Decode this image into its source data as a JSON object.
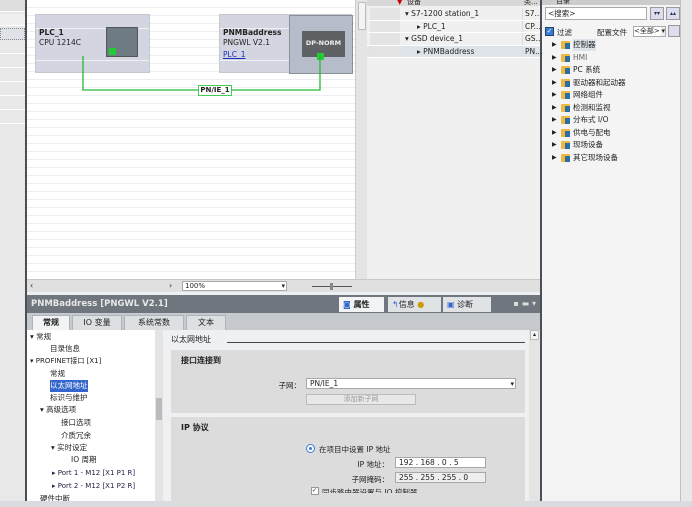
{
  "canvas": {
    "devices": [
      {
        "name": "PLC_1",
        "type": "CPU 1214C"
      },
      {
        "name": "PNMBaddress",
        "type": "PNGWL V2.1",
        "link": "PLC_1",
        "module": "DP-NORM"
      }
    ],
    "subnet_label": "PN/IE_1",
    "zoom": "100%"
  },
  "device_table": {
    "headers": [
      "设备",
      "类..."
    ],
    "rows": [
      {
        "name": "S7-1200 station_1",
        "type": "S7..."
      },
      {
        "name": "PLC_1",
        "type": "CP..."
      },
      {
        "name": "GSD device_1",
        "type": "GS..."
      },
      {
        "name": "PNMBaddress",
        "type": "PN..."
      }
    ]
  },
  "catalog": {
    "title": "目录",
    "search_placeholder": "<搜索>",
    "filter_label": "过滤",
    "profile_label": "配置文件",
    "profile_value": "<全部>",
    "items": [
      "控制器",
      "HMI",
      "PC 系统",
      "驱动器和起动器",
      "网络组件",
      "检测和监视",
      "分布式 I/O",
      "供电与配电",
      "现场设备",
      "其它现场设备"
    ]
  },
  "inspector": {
    "title": "PNMBaddress [PNGWL V2.1]",
    "view_tabs": [
      "属性",
      "信息",
      "诊断"
    ],
    "tabs": [
      "常规",
      "IO 变量",
      "系统常数",
      "文本"
    ],
    "nav": [
      "常规",
      "目录信息",
      "PROFINET接口 [X1]",
      "常规",
      "以太网地址",
      "标识与维护",
      "高级选项",
      "接口选项",
      "介质冗余",
      "实时设定",
      "IO 周期",
      "Port 1 - M12 [X1 P1 R]",
      "Port 2 - M12 [X1 P2 R]",
      "硬件中断"
    ],
    "section_title": "以太网地址",
    "interface_header": "接口连接到",
    "subnet_label": "子网：",
    "subnet_value": "PN/IE_1",
    "add_subnet": "添加新子网",
    "ip_header": "IP 协议",
    "ip_radio": "在项目中设置 IP 地址",
    "ip_label": "IP 地址：",
    "ip_value": "192 . 168 . 0    . 5",
    "mask_label": "子网掩码：",
    "mask_value": "255 . 255 . 255 . 0",
    "sync_label": "同步路由器设置与 IO 控制器"
  }
}
